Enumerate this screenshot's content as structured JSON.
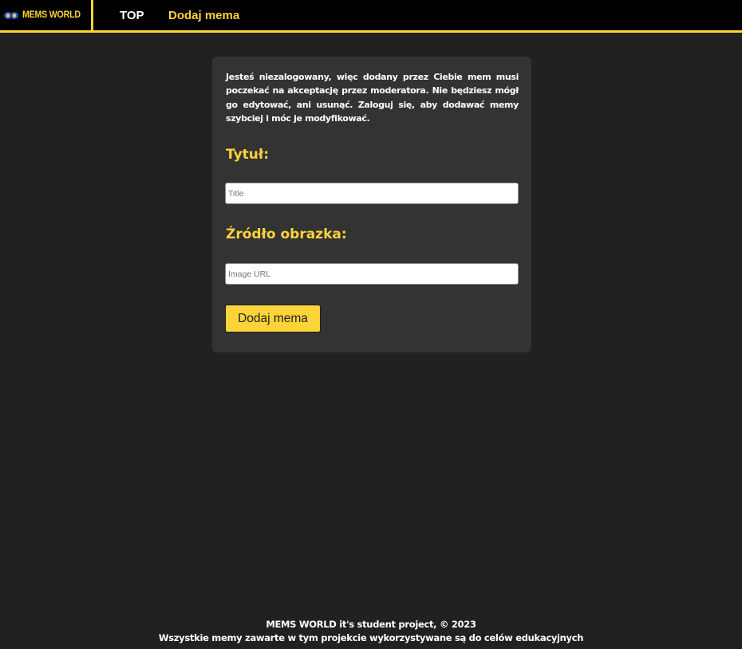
{
  "colors": {
    "page_background": "#212121",
    "navbar_background": "#000000",
    "accent": "#fdd33a",
    "card_background": "#333333",
    "text": "#ffffff"
  },
  "header": {
    "logo_text": "MEMS WORLD",
    "logo_icon": "brand-logo-icon",
    "nav": {
      "top_label": "TOP",
      "add_label": "Dodaj mema"
    }
  },
  "form": {
    "notice": "Jesteś niezalogowany, więc dodany przez Ciebie mem musi poczekać na akceptację przez moderatora. Nie będziesz mógł go edytować, ani usunąć. Zaloguj się, aby dodawać memy szybciej i móc je modyfikować.",
    "title_label": "Tytuł:",
    "title_value": "",
    "title_placeholder": "Title",
    "source_label": "Źródło obrazka:",
    "source_value": "",
    "source_placeholder": "Image URL",
    "submit_label": "Dodaj mema"
  },
  "footer": {
    "line1": "MEMS WORLD it's student project, © 2023",
    "line2": "Wszystkie memy zawarte w tym projekcie wykorzystywane są do celów edukacyjnych"
  }
}
